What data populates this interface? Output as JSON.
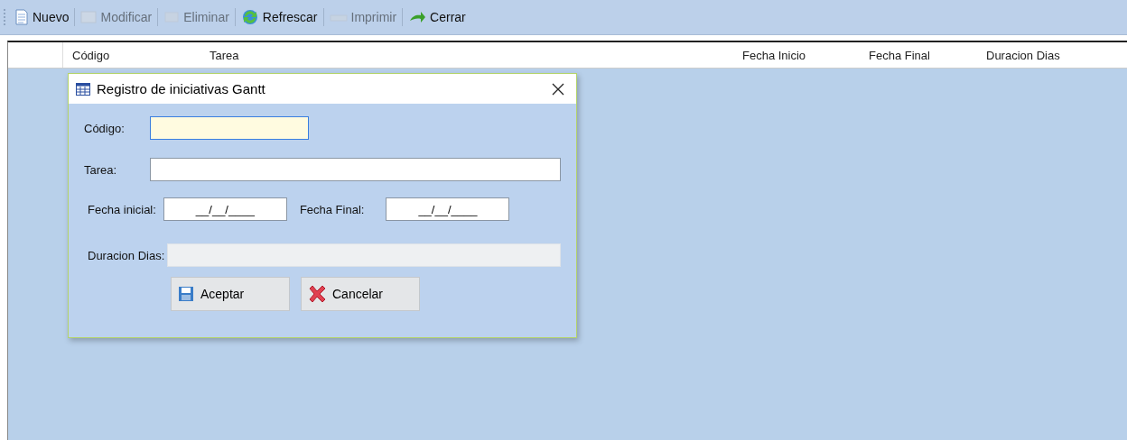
{
  "toolbar": [
    {
      "label": "Nuevo",
      "disabled": false
    },
    {
      "label": "Modificar",
      "disabled": true
    },
    {
      "label": "Eliminar",
      "disabled": true
    },
    {
      "label": "Refrescar",
      "disabled": false
    },
    {
      "label": "Imprimir",
      "disabled": true
    },
    {
      "label": "Cerrar",
      "disabled": false
    }
  ],
  "table": {
    "columns": [
      "Código",
      "Tarea",
      "Fecha Inicio",
      "Fecha Final",
      "Duracion Dias"
    ]
  },
  "dialog": {
    "title": "Registro de iniciativas Gantt",
    "fields": [
      {
        "label": "Código:",
        "focused": true,
        "disabled": false
      },
      {
        "label": "Tarea:",
        "focused": false,
        "disabled": false
      },
      {
        "label": "Fecha inicial:",
        "value": "__/__/____",
        "focused": false,
        "disabled": false
      },
      {
        "label": "Fecha Final:",
        "value": "__/__/____",
        "focused": false,
        "disabled": false
      },
      {
        "label": "Duracion Dias:",
        "focused": false,
        "disabled": true
      }
    ],
    "buttons": [
      {
        "label": "Aceptar"
      },
      {
        "label": "Cancelar"
      }
    ]
  }
}
